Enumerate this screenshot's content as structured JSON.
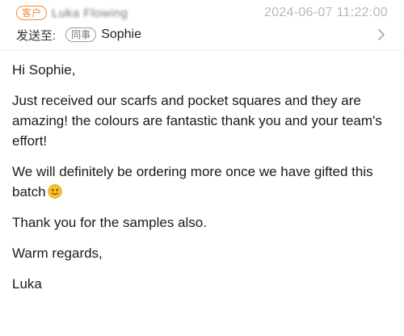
{
  "header": {
    "customer_tag": "客户",
    "sender_name": "Luka Flowing",
    "timestamp": "2024-06-07 11:22:00",
    "to_label": "发送至:",
    "colleague_tag": "同事",
    "recipient": "Sophie",
    "chevron_icon": "chevron-right-icon"
  },
  "message": {
    "greeting": "Hi Sophie,",
    "paragraph1": "Just received our scarfs and pocket squares and they are amazing! the colours are fantastic thank you and your team's effort!",
    "paragraph2": "We will definitely be ordering more once we have gifted this batch",
    "emoji_icon": "slightly-smiling-face-icon",
    "paragraph3": "Thank you for the samples also.",
    "closing": "Warm regards,",
    "signature": "Luka"
  },
  "colors": {
    "customer_tag": "#f28b3b",
    "timestamp": "#b8b8b8",
    "text": "#1a1a1a"
  }
}
